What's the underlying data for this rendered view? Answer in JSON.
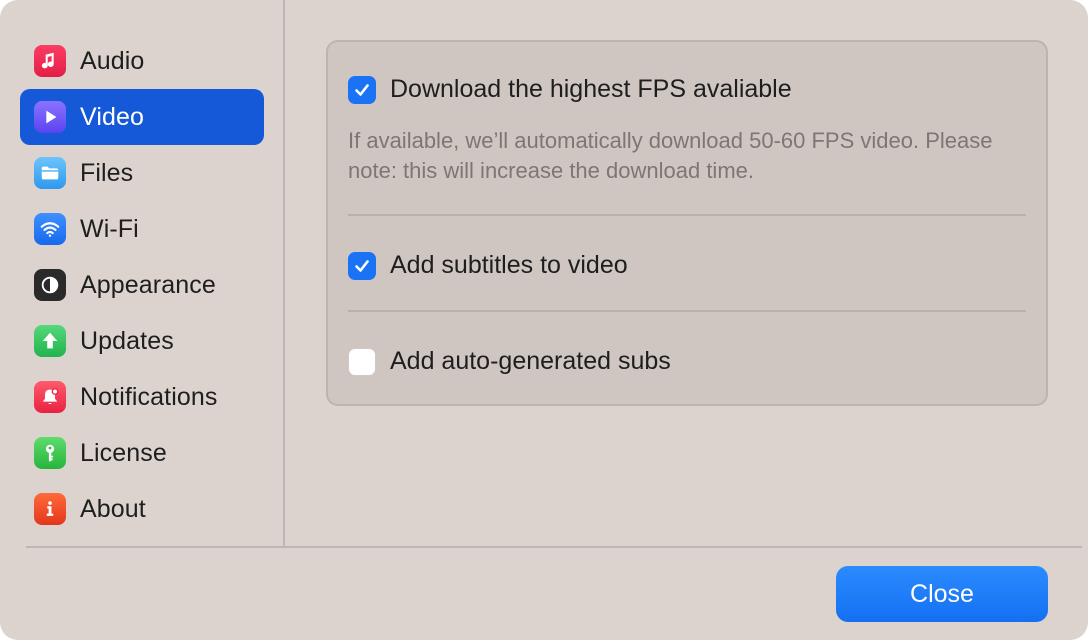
{
  "sidebar": {
    "items": [
      {
        "label": "Audio",
        "icon": "music-note-icon",
        "color": "#e9224a",
        "active": false
      },
      {
        "label": "Video",
        "icon": "play-icon",
        "color": "#6b5cff",
        "active": true
      },
      {
        "label": "Files",
        "icon": "folder-icon",
        "color": "#39a4f1",
        "active": false
      },
      {
        "label": "Wi-Fi",
        "icon": "wifi-icon",
        "color": "#1f7bf5",
        "active": false
      },
      {
        "label": "Appearance",
        "icon": "contrast-icon",
        "color": "#2a2a2a",
        "active": false
      },
      {
        "label": "Updates",
        "icon": "arrow-up-icon",
        "color": "#2dbf5e",
        "active": false
      },
      {
        "label": "Notifications",
        "icon": "bell-icon",
        "color": "#f0304a",
        "active": false
      },
      {
        "label": "License",
        "icon": "key-icon",
        "color": "#36c24a",
        "active": false
      },
      {
        "label": "About",
        "icon": "info-icon",
        "color": "#ea3f22",
        "active": false
      }
    ]
  },
  "video": {
    "fps": {
      "label": "Download the highest FPS avaliable",
      "checked": true
    },
    "fps_help": "If available, we’ll automatically download 50-60 FPS video. Please note: this will increase the download time.",
    "subtitles": {
      "label": "Add subtitles to video",
      "checked": true
    },
    "auto_subs": {
      "label": "Add auto-generated subs",
      "checked": false
    }
  },
  "footer": {
    "close_label": "Close"
  },
  "colors": {
    "accent": "#1659d8",
    "button": "#1a73f5"
  }
}
